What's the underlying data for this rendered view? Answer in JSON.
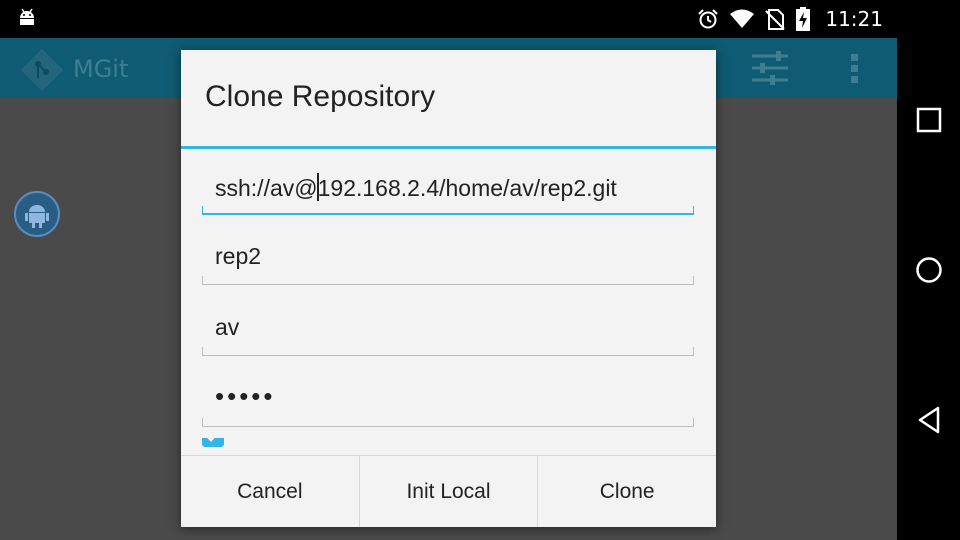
{
  "status_bar": {
    "time": "11:21",
    "icons": [
      "android-notification-icon",
      "alarm-icon",
      "wifi-icon",
      "no-sim-icon",
      "battery-charging-icon"
    ]
  },
  "app_bar": {
    "title": "MGit",
    "actions": [
      "settings-sliders-icon",
      "overflow-menu-icon"
    ]
  },
  "dialog": {
    "title": "Clone Repository",
    "fields": {
      "remote_url_before_cursor": "ssh://av@",
      "remote_url_after_cursor": "192.168.2.4/home/av/rep2.git",
      "local_path": "rep2",
      "username": "av",
      "password": "•••••"
    },
    "buttons": {
      "cancel": "Cancel",
      "init_local": "Init Local",
      "clone": "Clone"
    }
  },
  "colors": {
    "accent": "#33b5e5",
    "app_bar": "#0f5b73",
    "dialog_background": "#f3f3f3",
    "scrim": "#4a4a4a"
  }
}
